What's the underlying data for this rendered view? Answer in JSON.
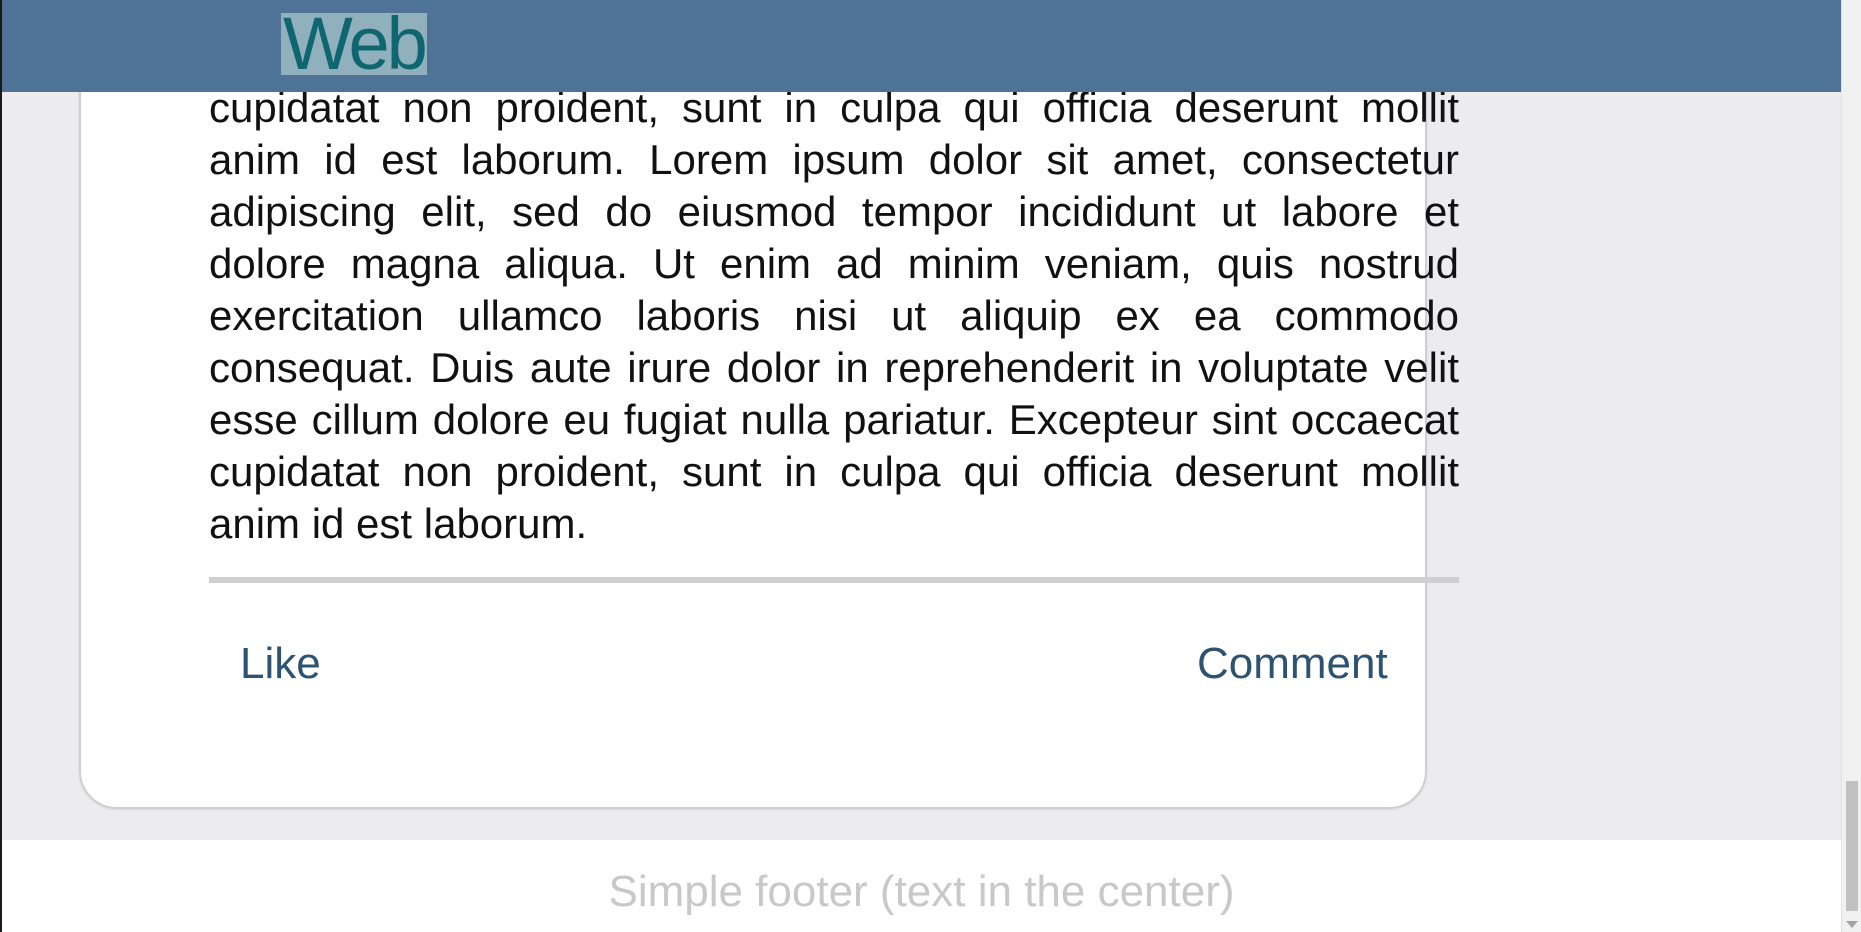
{
  "header": {
    "logo_text": "Web"
  },
  "post": {
    "body": "cillum dolore eu fugiat nulla pariatur. Excepteur sint occaecat cupidatat non proident, sunt in culpa qui officia deserunt mollit anim id est laborum. Lorem ipsum dolor sit amet, consectetur adipiscing elit, sed do eiusmod tempor incididunt ut labore et dolore magna aliqua. Ut enim ad minim veniam, quis nostrud exercitation ullamco laboris nisi ut aliquip ex ea commodo consequat. Duis aute irure dolor in reprehenderit in voluptate velit esse cillum dolore eu fugiat nulla pariatur. Excepteur sint occaecat cupidatat non proident, sunt in culpa qui officia deserunt mollit anim id est laborum.",
    "actions": {
      "like_label": "Like",
      "comment_label": "Comment"
    }
  },
  "footer": {
    "text": "Simple footer (text in the center)"
  },
  "colors": {
    "header_bg": "#4f7297",
    "logo_text": "#0f6671",
    "action_link": "#2d5373",
    "footer_text": "#c8c8c8",
    "page_bg": "#ececee"
  }
}
